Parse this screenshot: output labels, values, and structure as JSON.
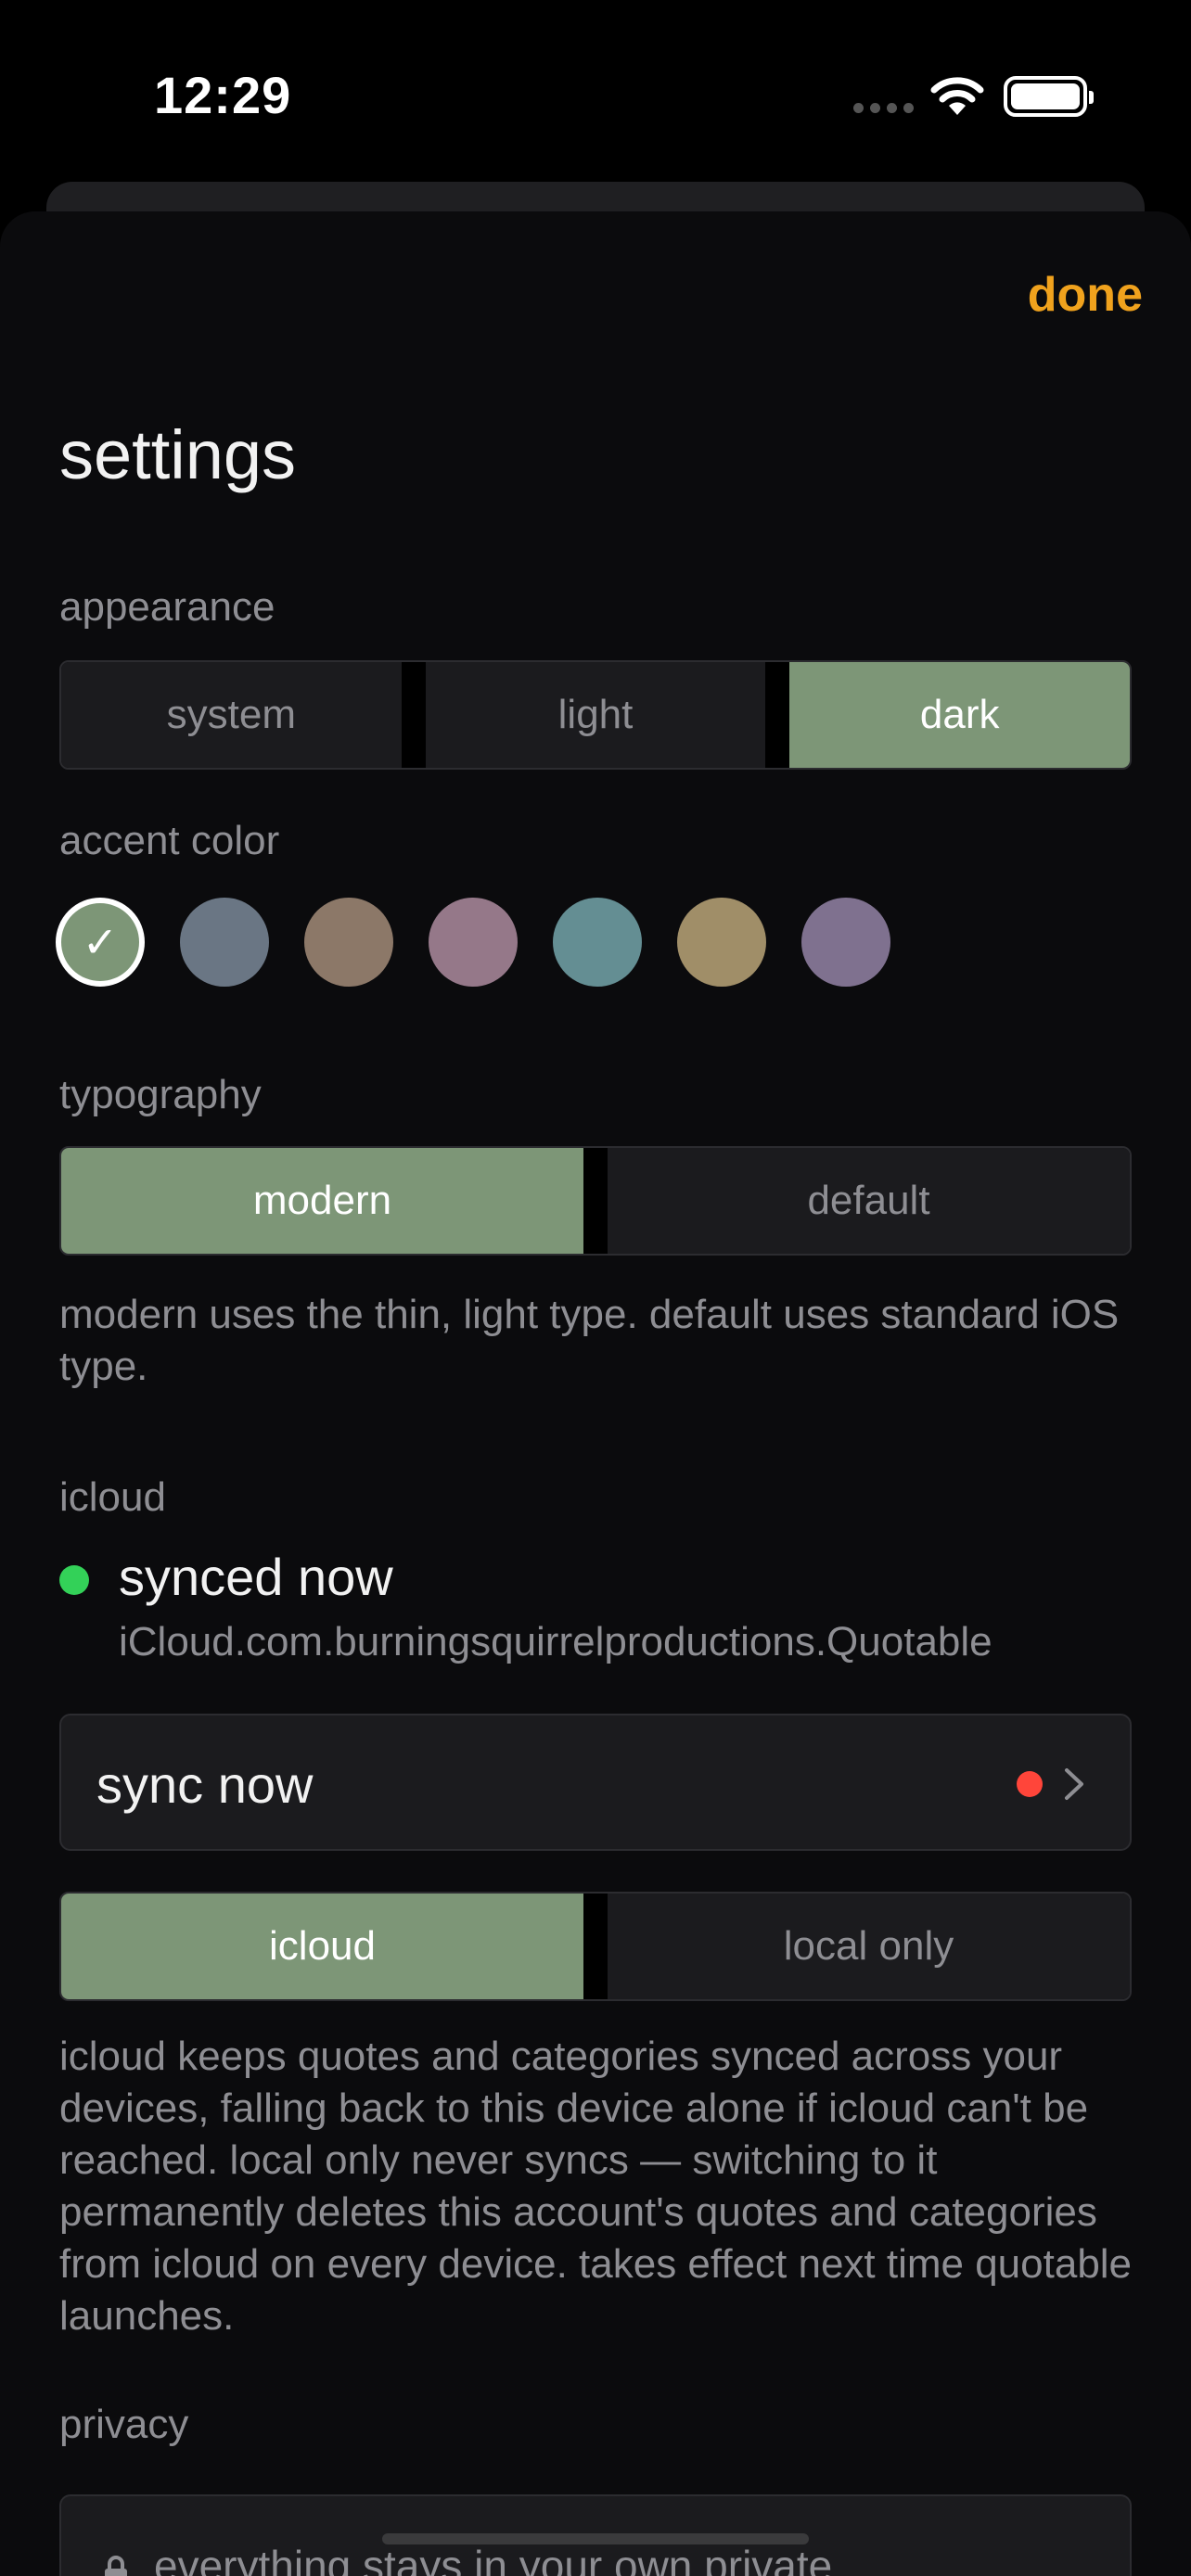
{
  "status_bar": {
    "time": "12:29",
    "signal_icon": "cellular-signal-icon",
    "wifi_icon": "wifi-icon",
    "battery_icon": "battery-icon"
  },
  "header": {
    "done_label": "done",
    "title": "settings"
  },
  "appearance": {
    "label": "appearance",
    "options": [
      "system",
      "light",
      "dark"
    ],
    "selected": "dark"
  },
  "accent_color": {
    "label": "accent color",
    "colors": [
      "#7d9677",
      "#6a7684",
      "#8c7868",
      "#957889",
      "#648e93",
      "#a08e68",
      "#7f718f"
    ],
    "selected_index": 0
  },
  "typography": {
    "label": "typography",
    "options": [
      "modern",
      "default"
    ],
    "selected": "modern",
    "help": "modern uses the thin, light type. default uses standard iOS type."
  },
  "icloud": {
    "label": "icloud",
    "status": "synced now",
    "status_color": "#33d158",
    "container": "iCloud.com.burningsquirrelproductions.Quotable",
    "sync_now_label": "sync now",
    "sync_options": [
      "icloud",
      "local only"
    ],
    "sync_selected": "icloud",
    "help": "icloud keeps quotes and categories synced across your devices, falling back to this device alone if icloud can't be reached. local only never syncs — switching to it permanently deletes this account's quotes and categories from icloud on every device. takes effect next time quotable launches."
  },
  "privacy": {
    "label": "privacy",
    "note": "everything stays in your own private"
  },
  "colors": {
    "accent": "#f0a21d",
    "selected_segment": "#7d9677",
    "background": "#0b0b0d",
    "alert_dot": "#ff453a"
  }
}
